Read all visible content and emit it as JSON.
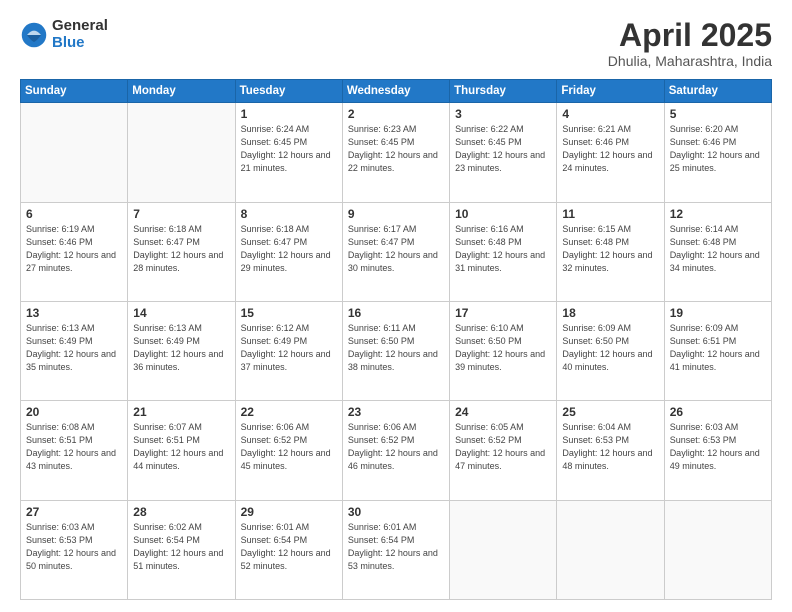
{
  "logo": {
    "general": "General",
    "blue": "Blue"
  },
  "title": {
    "month": "April 2025",
    "location": "Dhulia, Maharashtra, India"
  },
  "weekdays": [
    "Sunday",
    "Monday",
    "Tuesday",
    "Wednesday",
    "Thursday",
    "Friday",
    "Saturday"
  ],
  "weeks": [
    [
      {
        "day": "",
        "empty": true
      },
      {
        "day": "",
        "empty": true
      },
      {
        "day": "1",
        "sunrise": "Sunrise: 6:24 AM",
        "sunset": "Sunset: 6:45 PM",
        "daylight": "Daylight: 12 hours and 21 minutes."
      },
      {
        "day": "2",
        "sunrise": "Sunrise: 6:23 AM",
        "sunset": "Sunset: 6:45 PM",
        "daylight": "Daylight: 12 hours and 22 minutes."
      },
      {
        "day": "3",
        "sunrise": "Sunrise: 6:22 AM",
        "sunset": "Sunset: 6:45 PM",
        "daylight": "Daylight: 12 hours and 23 minutes."
      },
      {
        "day": "4",
        "sunrise": "Sunrise: 6:21 AM",
        "sunset": "Sunset: 6:46 PM",
        "daylight": "Daylight: 12 hours and 24 minutes."
      },
      {
        "day": "5",
        "sunrise": "Sunrise: 6:20 AM",
        "sunset": "Sunset: 6:46 PM",
        "daylight": "Daylight: 12 hours and 25 minutes."
      }
    ],
    [
      {
        "day": "6",
        "sunrise": "Sunrise: 6:19 AM",
        "sunset": "Sunset: 6:46 PM",
        "daylight": "Daylight: 12 hours and 27 minutes."
      },
      {
        "day": "7",
        "sunrise": "Sunrise: 6:18 AM",
        "sunset": "Sunset: 6:47 PM",
        "daylight": "Daylight: 12 hours and 28 minutes."
      },
      {
        "day": "8",
        "sunrise": "Sunrise: 6:18 AM",
        "sunset": "Sunset: 6:47 PM",
        "daylight": "Daylight: 12 hours and 29 minutes."
      },
      {
        "day": "9",
        "sunrise": "Sunrise: 6:17 AM",
        "sunset": "Sunset: 6:47 PM",
        "daylight": "Daylight: 12 hours and 30 minutes."
      },
      {
        "day": "10",
        "sunrise": "Sunrise: 6:16 AM",
        "sunset": "Sunset: 6:48 PM",
        "daylight": "Daylight: 12 hours and 31 minutes."
      },
      {
        "day": "11",
        "sunrise": "Sunrise: 6:15 AM",
        "sunset": "Sunset: 6:48 PM",
        "daylight": "Daylight: 12 hours and 32 minutes."
      },
      {
        "day": "12",
        "sunrise": "Sunrise: 6:14 AM",
        "sunset": "Sunset: 6:48 PM",
        "daylight": "Daylight: 12 hours and 34 minutes."
      }
    ],
    [
      {
        "day": "13",
        "sunrise": "Sunrise: 6:13 AM",
        "sunset": "Sunset: 6:49 PM",
        "daylight": "Daylight: 12 hours and 35 minutes."
      },
      {
        "day": "14",
        "sunrise": "Sunrise: 6:13 AM",
        "sunset": "Sunset: 6:49 PM",
        "daylight": "Daylight: 12 hours and 36 minutes."
      },
      {
        "day": "15",
        "sunrise": "Sunrise: 6:12 AM",
        "sunset": "Sunset: 6:49 PM",
        "daylight": "Daylight: 12 hours and 37 minutes."
      },
      {
        "day": "16",
        "sunrise": "Sunrise: 6:11 AM",
        "sunset": "Sunset: 6:50 PM",
        "daylight": "Daylight: 12 hours and 38 minutes."
      },
      {
        "day": "17",
        "sunrise": "Sunrise: 6:10 AM",
        "sunset": "Sunset: 6:50 PM",
        "daylight": "Daylight: 12 hours and 39 minutes."
      },
      {
        "day": "18",
        "sunrise": "Sunrise: 6:09 AM",
        "sunset": "Sunset: 6:50 PM",
        "daylight": "Daylight: 12 hours and 40 minutes."
      },
      {
        "day": "19",
        "sunrise": "Sunrise: 6:09 AM",
        "sunset": "Sunset: 6:51 PM",
        "daylight": "Daylight: 12 hours and 41 minutes."
      }
    ],
    [
      {
        "day": "20",
        "sunrise": "Sunrise: 6:08 AM",
        "sunset": "Sunset: 6:51 PM",
        "daylight": "Daylight: 12 hours and 43 minutes."
      },
      {
        "day": "21",
        "sunrise": "Sunrise: 6:07 AM",
        "sunset": "Sunset: 6:51 PM",
        "daylight": "Daylight: 12 hours and 44 minutes."
      },
      {
        "day": "22",
        "sunrise": "Sunrise: 6:06 AM",
        "sunset": "Sunset: 6:52 PM",
        "daylight": "Daylight: 12 hours and 45 minutes."
      },
      {
        "day": "23",
        "sunrise": "Sunrise: 6:06 AM",
        "sunset": "Sunset: 6:52 PM",
        "daylight": "Daylight: 12 hours and 46 minutes."
      },
      {
        "day": "24",
        "sunrise": "Sunrise: 6:05 AM",
        "sunset": "Sunset: 6:52 PM",
        "daylight": "Daylight: 12 hours and 47 minutes."
      },
      {
        "day": "25",
        "sunrise": "Sunrise: 6:04 AM",
        "sunset": "Sunset: 6:53 PM",
        "daylight": "Daylight: 12 hours and 48 minutes."
      },
      {
        "day": "26",
        "sunrise": "Sunrise: 6:03 AM",
        "sunset": "Sunset: 6:53 PM",
        "daylight": "Daylight: 12 hours and 49 minutes."
      }
    ],
    [
      {
        "day": "27",
        "sunrise": "Sunrise: 6:03 AM",
        "sunset": "Sunset: 6:53 PM",
        "daylight": "Daylight: 12 hours and 50 minutes."
      },
      {
        "day": "28",
        "sunrise": "Sunrise: 6:02 AM",
        "sunset": "Sunset: 6:54 PM",
        "daylight": "Daylight: 12 hours and 51 minutes."
      },
      {
        "day": "29",
        "sunrise": "Sunrise: 6:01 AM",
        "sunset": "Sunset: 6:54 PM",
        "daylight": "Daylight: 12 hours and 52 minutes."
      },
      {
        "day": "30",
        "sunrise": "Sunrise: 6:01 AM",
        "sunset": "Sunset: 6:54 PM",
        "daylight": "Daylight: 12 hours and 53 minutes."
      },
      {
        "day": "",
        "empty": true
      },
      {
        "day": "",
        "empty": true
      },
      {
        "day": "",
        "empty": true
      }
    ]
  ]
}
